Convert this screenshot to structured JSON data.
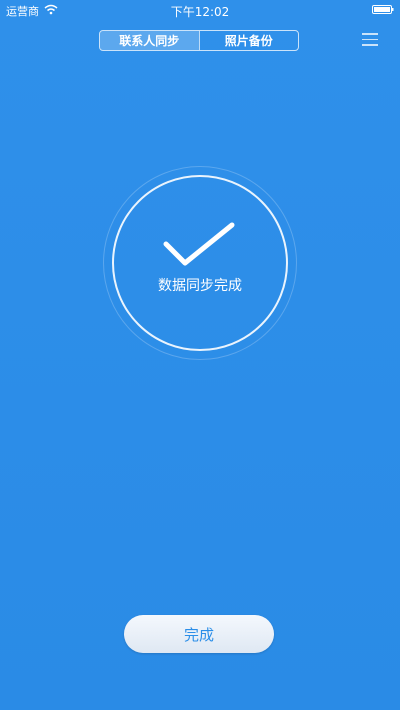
{
  "status_bar": {
    "carrier": "运营商",
    "time": "下午12:02",
    "wifi_icon": "wifi-icon",
    "battery_icon": "battery-icon"
  },
  "tabs": [
    {
      "label": "联系人同步",
      "active": true
    },
    {
      "label": "照片备份",
      "active": false
    }
  ],
  "menu_icon": "menu-icon",
  "status": {
    "icon": "checkmark-icon",
    "message": "数据同步完成"
  },
  "done_button": {
    "label": "完成"
  },
  "colors": {
    "background": "#2b8ee8",
    "button_text": "#2b8ee8",
    "button_bg": "#eef3fa"
  }
}
